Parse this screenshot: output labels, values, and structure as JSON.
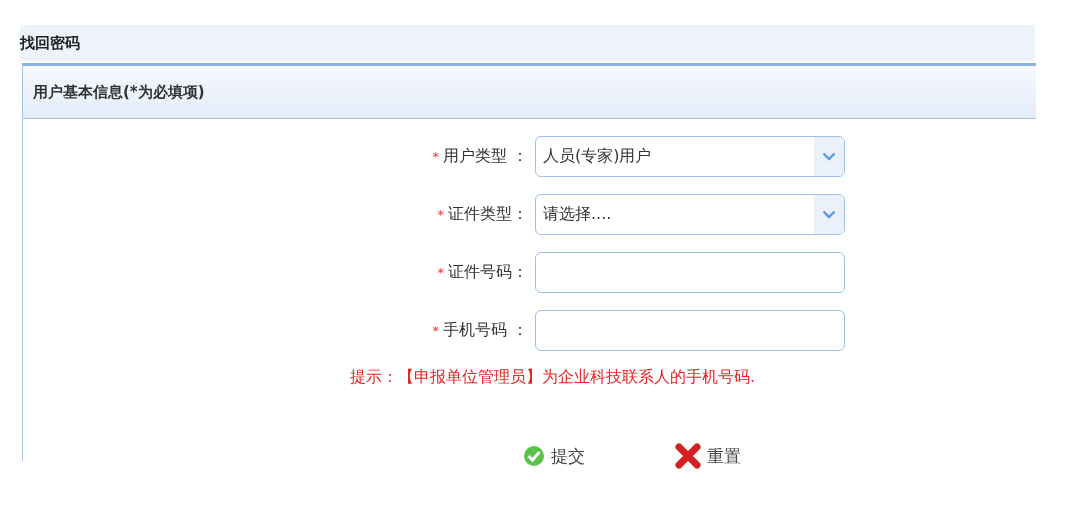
{
  "page_title": "找回密码",
  "panel": {
    "title": "用户基本信息(*为必填项)",
    "fields": [
      {
        "kind": "select",
        "required_mark": "*",
        "label": "用户类型 ：",
        "value": "人员(专家)用户"
      },
      {
        "kind": "select",
        "required_mark": "*",
        "label": "证件类型：",
        "value": "请选择...."
      },
      {
        "kind": "text",
        "required_mark": "*",
        "label": "证件号码："
      },
      {
        "kind": "text",
        "required_mark": "*",
        "label": "手机号码 ："
      }
    ],
    "hint": {
      "prefix": "提示：",
      "highlight": "【申报单位管理员】",
      "rest": "为企业科技联系人的手机号码."
    },
    "buttons": [
      {
        "kind": "submit",
        "label": "提交"
      },
      {
        "kind": "reset",
        "label": "重置"
      }
    ]
  }
}
